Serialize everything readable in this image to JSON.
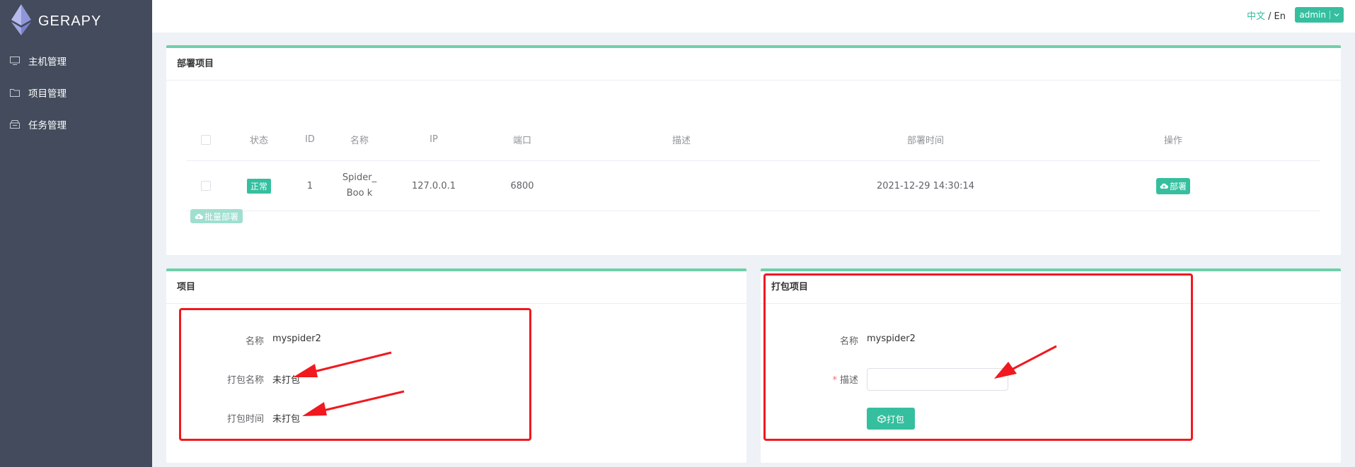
{
  "app": {
    "logo_text": "GERAPY"
  },
  "sidebar": {
    "items": [
      {
        "label": "主机管理",
        "icon": "monitor-icon"
      },
      {
        "label": "项目管理",
        "icon": "folder-icon"
      },
      {
        "label": "任务管理",
        "icon": "task-icon"
      }
    ]
  },
  "header": {
    "lang_zh": "中文",
    "lang_sep": "/",
    "lang_en": "En",
    "user": "admin"
  },
  "deploy_panel": {
    "title": "部署项目",
    "columns": [
      "状态",
      "ID",
      "名称",
      "IP",
      "端口",
      "描述",
      "部署时间",
      "操作"
    ],
    "rows": [
      {
        "status": "正常",
        "id": "1",
        "name": "Spider_Boo k",
        "ip": "127.0.0.1",
        "port": "6800",
        "desc": "",
        "time": "2021-12-29 14:30:14",
        "action": "部署"
      }
    ],
    "batch_label": "批量部署"
  },
  "project_panel": {
    "title": "项目",
    "name_label": "名称",
    "name_value": "myspider2",
    "pack_name_label": "打包名称",
    "pack_name_value": "未打包",
    "pack_time_label": "打包时间",
    "pack_time_value": "未打包"
  },
  "pack_panel": {
    "title": "打包项目",
    "name_label": "名称",
    "name_value": "myspider2",
    "desc_required": "*",
    "desc_label": "描述",
    "desc_value": "",
    "pack_button": "打包"
  },
  "colors": {
    "accent": "#35bf9f",
    "sidebar_bg": "#434b5c",
    "panel_border": "#6fcfa9",
    "annotation": "#f0191f"
  }
}
